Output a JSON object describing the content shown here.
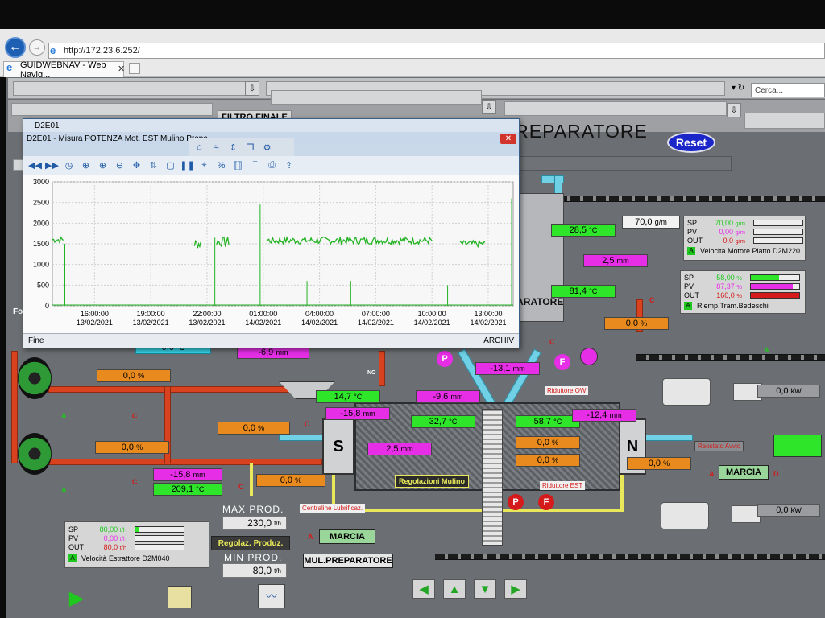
{
  "browser": {
    "url": "http://172.23.6.252/",
    "tab_title": "GUIDWEBNAV - Web Navig...",
    "tab_close": "✕",
    "search_placeholder": "Cerca..."
  },
  "scada": {
    "filter_button": "FILTRO FINALE",
    "title": "MULINO PREPARATORE",
    "reset_button": "Reset",
    "values": {
      "top_temp": "28,5",
      "top_temp_unit": "°C",
      "gm_value": "70,0",
      "gm_unit": "g/m",
      "gm_label": "g/m",
      "mm_2_5_top": "2,5",
      "mm_unit": "mm",
      "temp_81_4": "81,4",
      "pct_right_0": "0,0",
      "pct_unit": "%",
      "neg_6_9": "-6,9",
      "neg_13_1": "-13,1",
      "neg_9_6": "-9,6",
      "temp_14_7": "14,7",
      "neg_15_8_mid": "-15,8",
      "temp_32_7": "32,7",
      "temp_58_7": "58,7",
      "neg_12_4": "-12,4",
      "mm_2_5_mid": "2,5",
      "pct_a": "0,0",
      "pct_b": "0,0",
      "pct_c": "0,0",
      "pct_d": "0,0",
      "pct_e": "0,0",
      "pct_f": "0,0",
      "pct_g": "0,0",
      "neg_15_8_left": "-15,8",
      "temp_209_1": "209,1",
      "kw_1": "0,0",
      "kw_2": "0,0",
      "kw_unit": "kW",
      "partial_left": "0,0",
      "partial_left_unit": "°C"
    },
    "labels": {
      "preparatore_partial": "PARATORE",
      "riduttore_ow": "Riduttore OW",
      "riduttore_est": "Riduttore EST",
      "regolazioni_mulino": "Regolazioni Mulino",
      "centraline": "Centraline Lubrificaz.",
      "reostato": "Reostato Avvio",
      "marcia_right": "MARCIA",
      "marcia_left": "MARCIA",
      "mul_preparatore": "MUL.PREPARATORE",
      "regolaz_produz": "Regolaz. Produz.",
      "max_prod": "MAX PROD.",
      "max_prod_value": "230,0",
      "min_prod": "MIN PROD.",
      "min_prod_value": "80,0",
      "prod_unit": "t/h",
      "s_letter": "S",
      "n_letter": "N",
      "letter_a": "A",
      "letter_c": "C",
      "letter_d": "D",
      "letter_p": "P",
      "letter_f": "F",
      "no_label": "NO",
      "left_edge": "Fo"
    },
    "panel_motor": {
      "sp_label": "SP",
      "sp_value": "70,00",
      "sp_unit": "g/m",
      "pv_label": "PV",
      "pv_value": "0,00",
      "pv_unit": "g/m",
      "out_label": "OUT",
      "out_value": "0,0",
      "out_unit": "g/m",
      "caption": "Velocità Motore Piatto D2M220",
      "a_tag": "A",
      "sp_fill": 0,
      "pv_fill": 0,
      "out_fill": 0
    },
    "panel_tram": {
      "sp_label": "SP",
      "sp_value": "58,00",
      "sp_unit": "%",
      "pv_label": "PV",
      "pv_value": "87,37",
      "pv_unit": "%",
      "out_label": "OUT",
      "out_value": "160,0",
      "out_unit": "%",
      "caption": "Riemp.Tram.Bedeschi",
      "a_tag": "A",
      "sp_fill": 0.58,
      "pv_fill": 0.87,
      "out_fill": 1.0
    },
    "panel_estrattore": {
      "sp_label": "SP",
      "sp_value": "80,00",
      "sp_unit": "t/h",
      "pv_label": "PV",
      "pv_value": "0,00",
      "pv_unit": "t/h",
      "out_label": "OUT",
      "out_value": "80,0",
      "out_unit": "t/h",
      "caption": "Velocità Estrattore D2M040",
      "a_tag": "A",
      "sp_fill": 0.08,
      "pv_fill": 0,
      "out_fill": 0
    },
    "colors": {
      "green_tag": "#2ee52a",
      "magenta_tag": "#e62ee6",
      "orange_tag": "#e88a1e",
      "background": "#6b6e72"
    }
  },
  "chart_window": {
    "tab_title": "D2E01",
    "caption": "D2E01 - Misura POTENZA Mot. EST Mulino Prepa",
    "close_label": "✕",
    "status_left": "Fine",
    "status_right": "ARCHIV"
  },
  "chart_data": {
    "type": "line",
    "title": "",
    "xlabel": "",
    "ylabel": "",
    "ylim": [
      0,
      3000
    ],
    "y_ticks": [
      0,
      500,
      1000,
      1500,
      2000,
      2500,
      3000
    ],
    "x_ticks": [
      {
        "time": "16:00:00",
        "date": "13/02/2021"
      },
      {
        "time": "19:00:00",
        "date": "13/02/2021"
      },
      {
        "time": "22:00:00",
        "date": "13/02/2021"
      },
      {
        "time": "01:00:00",
        "date": "14/02/2021"
      },
      {
        "time": "04:00:00",
        "date": "14/02/2021"
      },
      {
        "time": "07:00:00",
        "date": "14/02/2021"
      },
      {
        "time": "10:00:00",
        "date": "14/02/2021"
      },
      {
        "time": "13:00:00",
        "date": "14/02/2021"
      }
    ],
    "xlim": [
      "13/02/2021 13:45",
      "14/02/2021 14:20"
    ],
    "grid": true,
    "series": [
      {
        "color": "#22b322",
        "segments": [
          {
            "from": "13/02/2021 13:45",
            "to": "13/02/2021 14:20",
            "level": 1600,
            "noise": 80
          },
          {
            "from": "13/02/2021 21:20",
            "to": "13/02/2021 21:40",
            "level": 1500,
            "noise": 120
          },
          {
            "from": "13/02/2021 22:30",
            "to": "13/02/2021 23:10",
            "level": 1550,
            "noise": 120
          },
          {
            "from": "14/02/2021 01:10",
            "to": "14/02/2021 10:00",
            "level": 1580,
            "noise": 90
          },
          {
            "from": "14/02/2021 11:30",
            "to": "14/02/2021 12:50",
            "level": 1500,
            "noise": 80
          }
        ],
        "spikes": [
          {
            "at": "13/02/2021 14:25",
            "value": 1500
          },
          {
            "at": "13/02/2021 21:15",
            "value": 1600
          },
          {
            "at": "13/02/2021 22:25",
            "value": 1650
          },
          {
            "at": "14/02/2021 00:50",
            "value": 2450
          },
          {
            "at": "14/02/2021 03:20",
            "value": 600
          },
          {
            "at": "14/02/2021 05:40",
            "value": 600
          },
          {
            "at": "14/02/2021 10:50",
            "value": 500
          },
          {
            "at": "14/02/2021 14:15",
            "value": 2600
          }
        ]
      }
    ]
  },
  "bottom_nav": {
    "play_icon": "play-icon",
    "arrows": [
      "◀",
      "▲",
      "▼",
      "▶"
    ]
  }
}
